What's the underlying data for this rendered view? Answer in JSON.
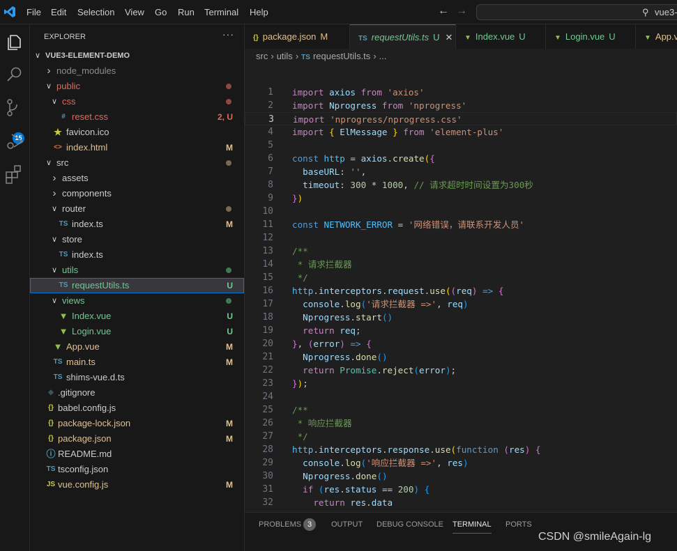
{
  "colors": {
    "accent": "#0078d4",
    "untracked": "#73c991",
    "modified": "#e2c08d",
    "error": "#e06c5a",
    "ignored": "#8c8c8c"
  },
  "menu": [
    "File",
    "Edit",
    "Selection",
    "View",
    "Go",
    "Run",
    "Terminal",
    "Help"
  ],
  "search": {
    "icon": "search-icon",
    "text": "vue3-"
  },
  "activity": {
    "scm_badge": "15"
  },
  "explorer": {
    "title": "EXPLORER",
    "more": "···",
    "items": [
      {
        "label": "VUE3-ELEMENT-DEMO",
        "depth": 0,
        "type": "folder",
        "open": true,
        "root": true
      },
      {
        "label": "node_modules",
        "depth": 1,
        "type": "folder",
        "open": false,
        "status": "ignored"
      },
      {
        "label": "public",
        "depth": 1,
        "type": "folder",
        "open": true,
        "status": "error",
        "dot": true
      },
      {
        "label": "css",
        "depth": 2,
        "type": "folder",
        "open": true,
        "status": "error",
        "dot": true
      },
      {
        "label": "reset.css",
        "depth": 3,
        "type": "file",
        "icon": "css",
        "status": "error",
        "badge": "2, U"
      },
      {
        "label": "favicon.ico",
        "depth": 2,
        "type": "file",
        "icon": "star"
      },
      {
        "label": "index.html",
        "depth": 2,
        "type": "file",
        "icon": "html",
        "status": "modified",
        "badge": "M"
      },
      {
        "label": "src",
        "depth": 1,
        "type": "folder",
        "open": true,
        "dot": true,
        "dotColor": "#7a6a4f"
      },
      {
        "label": "assets",
        "depth": 2,
        "type": "folder",
        "open": false
      },
      {
        "label": "components",
        "depth": 2,
        "type": "folder",
        "open": false
      },
      {
        "label": "router",
        "depth": 2,
        "type": "folder",
        "open": true,
        "dot": true,
        "dotColor": "#7a6a4f"
      },
      {
        "label": "index.ts",
        "depth": 3,
        "type": "file",
        "icon": "ts",
        "badge": "M",
        "status": "modified-badge"
      },
      {
        "label": "store",
        "depth": 2,
        "type": "folder",
        "open": true
      },
      {
        "label": "index.ts",
        "depth": 3,
        "type": "file",
        "icon": "ts"
      },
      {
        "label": "utils",
        "depth": 2,
        "type": "folder",
        "open": true,
        "status": "untracked",
        "dot": true
      },
      {
        "label": "requestUtils.ts",
        "depth": 3,
        "type": "file",
        "icon": "ts",
        "status": "untracked",
        "badge": "U",
        "selected": true
      },
      {
        "label": "views",
        "depth": 2,
        "type": "folder",
        "open": true,
        "status": "untracked",
        "dot": true
      },
      {
        "label": "Index.vue",
        "depth": 3,
        "type": "file",
        "icon": "vue",
        "status": "untracked",
        "badge": "U"
      },
      {
        "label": "Login.vue",
        "depth": 3,
        "type": "file",
        "icon": "vue",
        "status": "untracked",
        "badge": "U"
      },
      {
        "label": "App.vue",
        "depth": 2,
        "type": "file",
        "icon": "vue",
        "status": "modified",
        "badge": "M"
      },
      {
        "label": "main.ts",
        "depth": 2,
        "type": "file",
        "icon": "ts",
        "status": "modified",
        "badge": "M"
      },
      {
        "label": "shims-vue.d.ts",
        "depth": 2,
        "type": "file",
        "icon": "ts"
      },
      {
        "label": ".gitignore",
        "depth": 1,
        "type": "file",
        "icon": "git"
      },
      {
        "label": "babel.config.js",
        "depth": 1,
        "type": "file",
        "icon": "json"
      },
      {
        "label": "package-lock.json",
        "depth": 1,
        "type": "file",
        "icon": "json",
        "status": "modified",
        "badge": "M"
      },
      {
        "label": "package.json",
        "depth": 1,
        "type": "file",
        "icon": "json",
        "status": "modified",
        "badge": "M"
      },
      {
        "label": "README.md",
        "depth": 1,
        "type": "file",
        "icon": "info"
      },
      {
        "label": "tsconfig.json",
        "depth": 1,
        "type": "file",
        "icon": "tsconfig"
      },
      {
        "label": "vue.config.js",
        "depth": 1,
        "type": "file",
        "icon": "js",
        "status": "modified",
        "badge": "M"
      }
    ]
  },
  "tabs": [
    {
      "label": "package.json",
      "icon": "json",
      "mark": "M",
      "color": "#e2c08d"
    },
    {
      "label": "requestUtils.ts",
      "icon": "ts",
      "mark": "U",
      "color": "#73c991",
      "active": true,
      "close": "✕"
    },
    {
      "label": "Index.vue",
      "icon": "vue",
      "mark": "U",
      "color": "#73c991"
    },
    {
      "label": "Login.vue",
      "icon": "vue",
      "mark": "U",
      "color": "#73c991"
    },
    {
      "label": "App.vue",
      "icon": "vue",
      "mark": "",
      "color": "#e2c08d"
    }
  ],
  "breadcrumb": [
    "src",
    "utils",
    "requestUtils.ts",
    "..."
  ],
  "editor": {
    "current_line": 3,
    "lines": [
      [
        [
          "k",
          "import "
        ],
        [
          "v",
          "axios "
        ],
        [
          "k",
          "from "
        ],
        [
          "s",
          "'axios'"
        ]
      ],
      [
        [
          "k",
          "import "
        ],
        [
          "v",
          "Nprogress "
        ],
        [
          "k",
          "from "
        ],
        [
          "s",
          "'nprogress'"
        ]
      ],
      [
        [
          "k",
          "import "
        ],
        [
          "s",
          "'nprogress/nprogress.css'"
        ]
      ],
      [
        [
          "k",
          "import "
        ],
        [
          "b1",
          "{ "
        ],
        [
          "v",
          "ElMessage "
        ],
        [
          "b1",
          "} "
        ],
        [
          "k",
          "from "
        ],
        [
          "s",
          "'element-plus'"
        ]
      ],
      [],
      [
        [
          "c",
          "const "
        ],
        [
          "cn",
          "http"
        ],
        [
          "p",
          " = "
        ],
        [
          "v",
          "axios"
        ],
        [
          "p",
          "."
        ],
        [
          "f",
          "create"
        ],
        [
          "b1",
          "("
        ],
        [
          "b2",
          "{"
        ]
      ],
      [
        [
          "p",
          "  "
        ],
        [
          "v",
          "baseURL"
        ],
        [
          "p",
          ": "
        ],
        [
          "s",
          "''"
        ],
        [
          "p",
          ","
        ]
      ],
      [
        [
          "p",
          "  "
        ],
        [
          "v",
          "timeout"
        ],
        [
          "p",
          ": "
        ],
        [
          "n",
          "300"
        ],
        [
          "p",
          " * "
        ],
        [
          "n",
          "1000"
        ],
        [
          "p",
          ", "
        ],
        [
          "m",
          "// 请求超时时间设置为300秒"
        ]
      ],
      [
        [
          "b2",
          "}"
        ],
        [
          "b1",
          ")"
        ]
      ],
      [],
      [
        [
          "c",
          "const "
        ],
        [
          "cn",
          "NETWORK_ERROR"
        ],
        [
          "p",
          " = "
        ],
        [
          "s",
          "'网络错误，请联系开发人员'"
        ]
      ],
      [],
      [
        [
          "m",
          "/**"
        ]
      ],
      [
        [
          "m",
          " * 请求拦截器"
        ]
      ],
      [
        [
          "m",
          " */"
        ]
      ],
      [
        [
          "cn",
          "http"
        ],
        [
          "p",
          "."
        ],
        [
          "v",
          "interceptors"
        ],
        [
          "p",
          "."
        ],
        [
          "v",
          "request"
        ],
        [
          "p",
          "."
        ],
        [
          "f",
          "use"
        ],
        [
          "b1",
          "("
        ],
        [
          "b2",
          "("
        ],
        [
          "v",
          "req"
        ],
        [
          "b2",
          ")"
        ],
        [
          "c",
          " =>"
        ],
        [
          "p",
          " "
        ],
        [
          "b2",
          "{"
        ]
      ],
      [
        [
          "p",
          "  "
        ],
        [
          "v",
          "console"
        ],
        [
          "p",
          "."
        ],
        [
          "f",
          "log"
        ],
        [
          "b3",
          "("
        ],
        [
          "s",
          "'请求拦截器 =>'"
        ],
        [
          "p",
          ", "
        ],
        [
          "v",
          "req"
        ],
        [
          "b3",
          ")"
        ]
      ],
      [
        [
          "p",
          "  "
        ],
        [
          "v",
          "Nprogress"
        ],
        [
          "p",
          "."
        ],
        [
          "f",
          "start"
        ],
        [
          "b3",
          "()"
        ]
      ],
      [
        [
          "p",
          "  "
        ],
        [
          "k",
          "return "
        ],
        [
          "v",
          "req"
        ],
        [
          "p",
          ";"
        ]
      ],
      [
        [
          "b2",
          "}"
        ],
        [
          "p",
          ", "
        ],
        [
          "b2",
          "("
        ],
        [
          "v",
          "error"
        ],
        [
          "b2",
          ")"
        ],
        [
          "c",
          " =>"
        ],
        [
          "p",
          " "
        ],
        [
          "b2",
          "{"
        ]
      ],
      [
        [
          "p",
          "  "
        ],
        [
          "v",
          "Nprogress"
        ],
        [
          "p",
          "."
        ],
        [
          "f",
          "done"
        ],
        [
          "b3",
          "()"
        ]
      ],
      [
        [
          "p",
          "  "
        ],
        [
          "k",
          "return "
        ],
        [
          "t",
          "Promise"
        ],
        [
          "p",
          "."
        ],
        [
          "f",
          "reject"
        ],
        [
          "b3",
          "("
        ],
        [
          "v",
          "error"
        ],
        [
          "b3",
          ")"
        ],
        [
          "p",
          ";"
        ]
      ],
      [
        [
          "b2",
          "}"
        ],
        [
          "b1",
          ")"
        ],
        [
          "p",
          ";"
        ]
      ],
      [],
      [
        [
          "m",
          "/**"
        ]
      ],
      [
        [
          "m",
          " * 响应拦截器"
        ]
      ],
      [
        [
          "m",
          " */"
        ]
      ],
      [
        [
          "cn",
          "http"
        ],
        [
          "p",
          "."
        ],
        [
          "v",
          "interceptors"
        ],
        [
          "p",
          "."
        ],
        [
          "v",
          "response"
        ],
        [
          "p",
          "."
        ],
        [
          "f",
          "use"
        ],
        [
          "b1",
          "("
        ],
        [
          "c",
          "function "
        ],
        [
          "b2",
          "("
        ],
        [
          "v",
          "res"
        ],
        [
          "b2",
          ")"
        ],
        [
          "p",
          " "
        ],
        [
          "b2",
          "{"
        ]
      ],
      [
        [
          "p",
          "  "
        ],
        [
          "v",
          "console"
        ],
        [
          "p",
          "."
        ],
        [
          "f",
          "log"
        ],
        [
          "b3",
          "("
        ],
        [
          "s",
          "'响应拦截器 =>'"
        ],
        [
          "p",
          ", "
        ],
        [
          "v",
          "res"
        ],
        [
          "b3",
          ")"
        ]
      ],
      [
        [
          "p",
          "  "
        ],
        [
          "v",
          "Nprogress"
        ],
        [
          "p",
          "."
        ],
        [
          "f",
          "done"
        ],
        [
          "b3",
          "()"
        ]
      ],
      [
        [
          "p",
          "  "
        ],
        [
          "k",
          "if "
        ],
        [
          "b3",
          "("
        ],
        [
          "v",
          "res"
        ],
        [
          "p",
          "."
        ],
        [
          "v",
          "status"
        ],
        [
          "p",
          " == "
        ],
        [
          "n",
          "200"
        ],
        [
          "b3",
          ")"
        ],
        [
          "p",
          " "
        ],
        [
          "b3",
          "{"
        ]
      ],
      [
        [
          "p",
          "    "
        ],
        [
          "k",
          "return "
        ],
        [
          "v",
          "res"
        ],
        [
          "p",
          "."
        ],
        [
          "v",
          "data"
        ]
      ]
    ]
  },
  "panel": {
    "tabs": [
      "PROBLEMS",
      "OUTPUT",
      "DEBUG CONSOLE",
      "TERMINAL",
      "PORTS"
    ],
    "problems_count": "3",
    "active": "TERMINAL"
  },
  "watermark": "CSDN @smileAgain-lg"
}
